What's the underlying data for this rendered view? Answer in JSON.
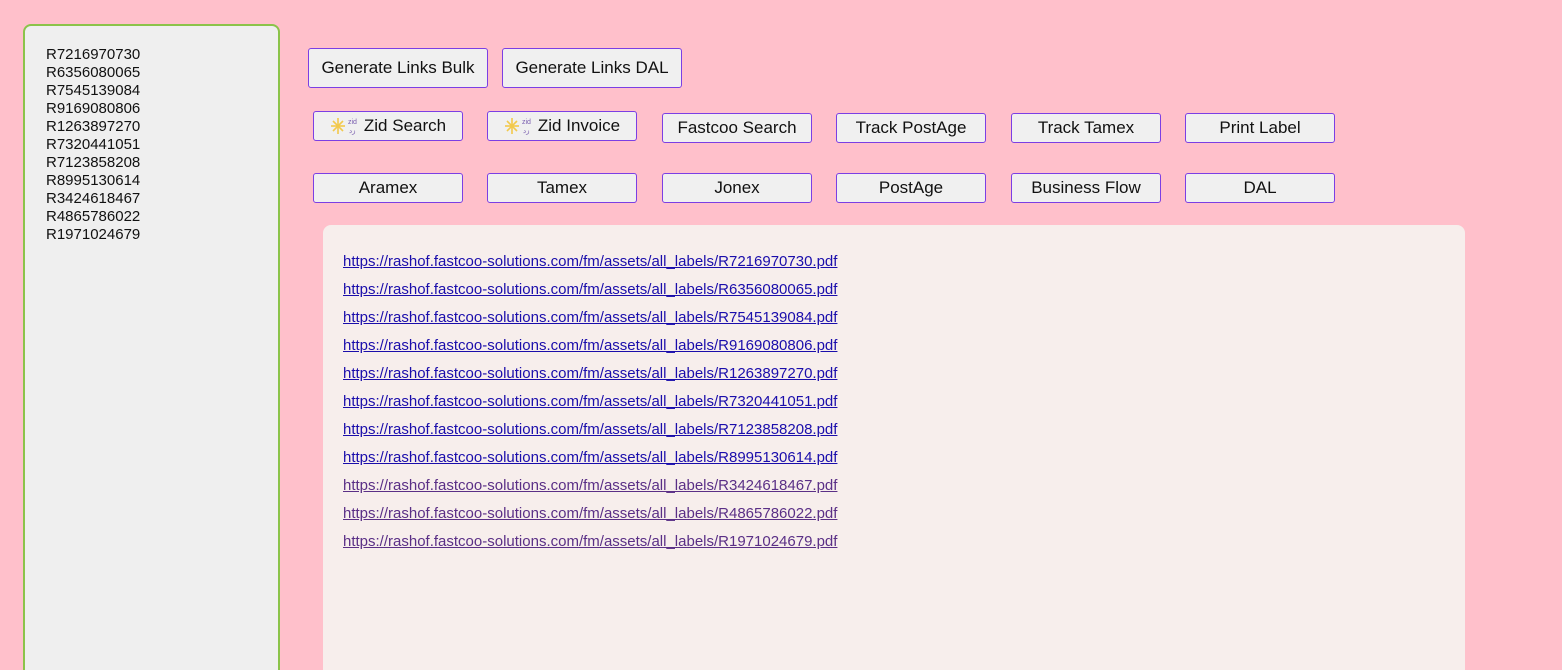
{
  "tracking_numbers": [
    "R7216970730",
    "R6356080065",
    "R7545139084",
    "R9169080806",
    "R1263897270",
    "R7320441051",
    "R7123858208",
    "R8995130614",
    "R3424618467",
    "R4865786022",
    "R1971024679"
  ],
  "actions": {
    "generate_bulk": "Generate Links Bulk",
    "generate_dal": "Generate Links DAL"
  },
  "tools": {
    "zid_search": "Zid Search",
    "zid_invoice": "Zid Invoice",
    "fastcoo_search": "Fastcoo Search",
    "track_postage": "Track PostAge",
    "track_tamex": "Track Tamex",
    "print_label": "Print Label",
    "zid_logo_text": "zid"
  },
  "carriers": {
    "aramex": "Aramex",
    "tamex": "Tamex",
    "jonex": "Jonex",
    "postage": "PostAge",
    "business_flow": "Business Flow",
    "dal": "DAL"
  },
  "links": [
    {
      "text": "https://rashof.fastcoo-solutions.com/fm/assets/all_labels/R7216970730.pdf",
      "visited": false
    },
    {
      "text": "https://rashof.fastcoo-solutions.com/fm/assets/all_labels/R6356080065.pdf",
      "visited": false
    },
    {
      "text": "https://rashof.fastcoo-solutions.com/fm/assets/all_labels/R7545139084.pdf",
      "visited": false
    },
    {
      "text": "https://rashof.fastcoo-solutions.com/fm/assets/all_labels/R9169080806.pdf",
      "visited": false
    },
    {
      "text": "https://rashof.fastcoo-solutions.com/fm/assets/all_labels/R1263897270.pdf",
      "visited": false
    },
    {
      "text": "https://rashof.fastcoo-solutions.com/fm/assets/all_labels/R7320441051.pdf",
      "visited": false
    },
    {
      "text": "https://rashof.fastcoo-solutions.com/fm/assets/all_labels/R7123858208.pdf",
      "visited": false
    },
    {
      "text": "https://rashof.fastcoo-solutions.com/fm/assets/all_labels/R8995130614.pdf",
      "visited": false
    },
    {
      "text": "https://rashof.fastcoo-solutions.com/fm/assets/all_labels/R3424618467.pdf",
      "visited": true
    },
    {
      "text": "https://rashof.fastcoo-solutions.com/fm/assets/all_labels/R4865786022.pdf",
      "visited": true
    },
    {
      "text": "https://rashof.fastcoo-solutions.com/fm/assets/all_labels/R1971024679.pdf",
      "visited": true
    }
  ],
  "colors": {
    "background": "#ffc0cb",
    "textarea_border": "#8bc34a",
    "button_border": "#7b3fe4",
    "link": "#1a0dab",
    "link_visited": "#5a2f86",
    "panel": "#f7eeec"
  }
}
